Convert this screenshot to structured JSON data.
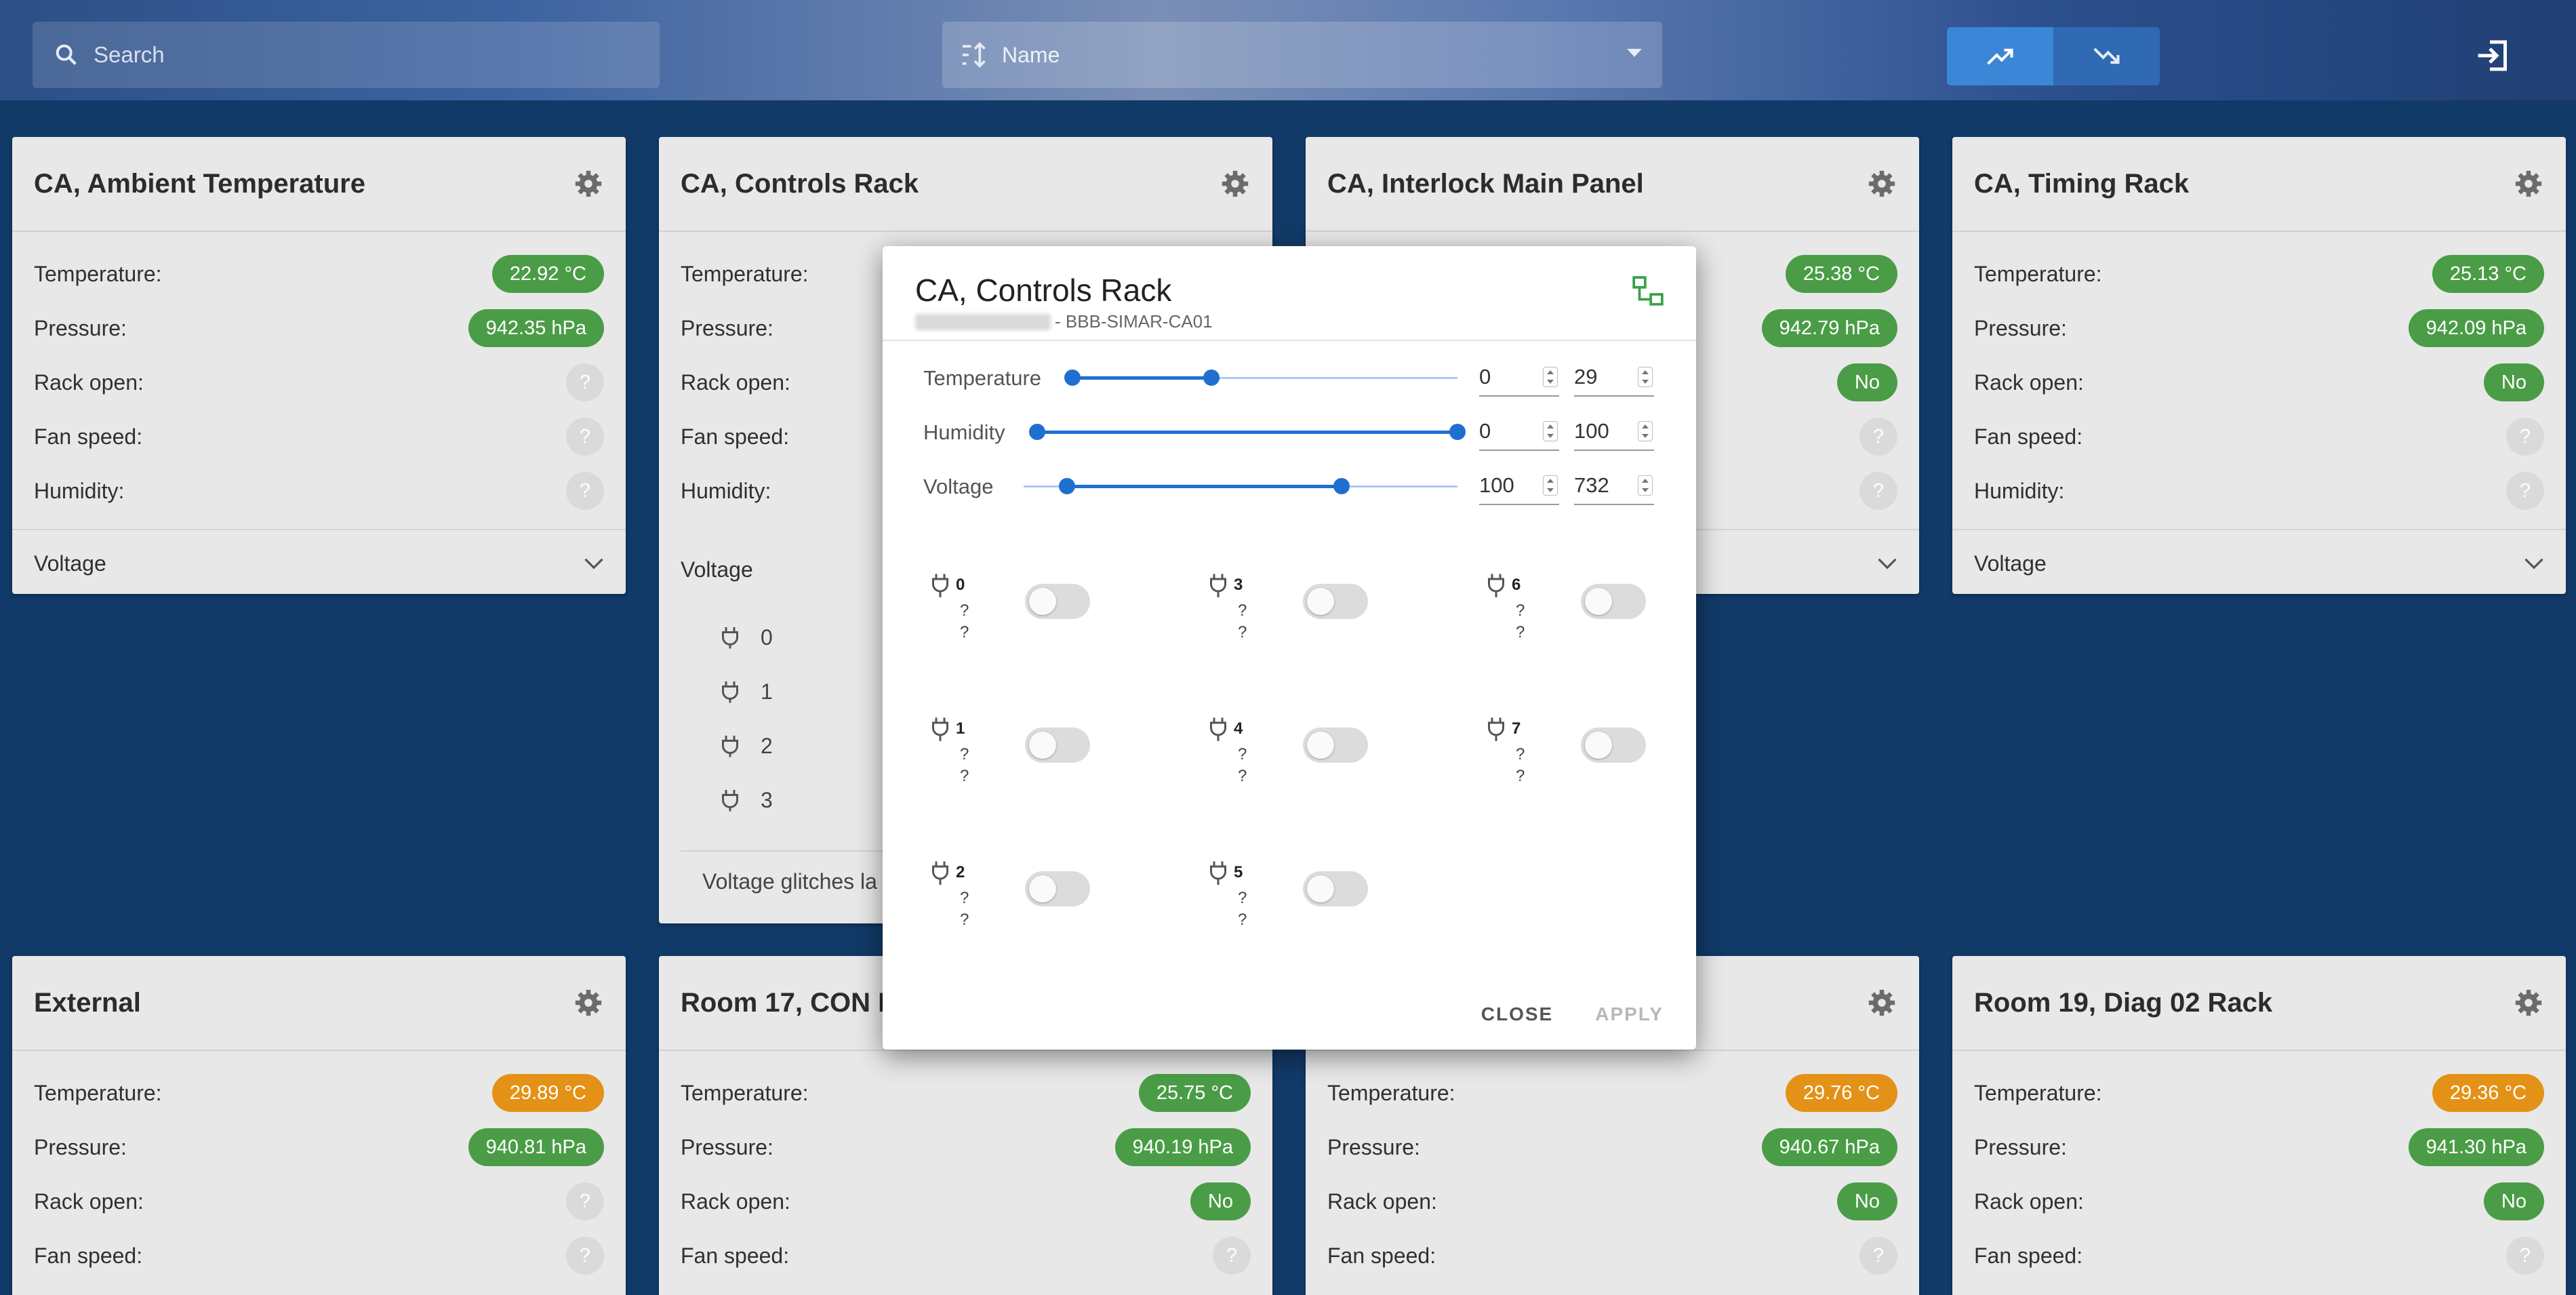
{
  "topbar": {
    "search_placeholder": "Search",
    "sort_label": "Name",
    "icons": [
      "search-icon",
      "sort-icon",
      "trending-up-icon",
      "trending-down-icon",
      "login-icon"
    ]
  },
  "cards_top": [
    {
      "title": "CA, Ambient Temperature",
      "rows": [
        {
          "label": "Temperature:",
          "value": "22.92 °C",
          "status": "green"
        },
        {
          "label": "Pressure:",
          "value": "942.35 hPa",
          "status": "green"
        },
        {
          "label": "Rack open:",
          "value": "?",
          "status": "grey"
        },
        {
          "label": "Fan speed:",
          "value": "?",
          "status": "grey"
        },
        {
          "label": "Humidity:",
          "value": "?",
          "status": "grey"
        }
      ],
      "voltage_label": "Voltage"
    },
    {
      "title": "CA, Controls Rack",
      "rows": [
        {
          "label": "Temperature:"
        },
        {
          "label": "Pressure:"
        },
        {
          "label": "Rack open:"
        },
        {
          "label": "Fan speed:"
        },
        {
          "label": "Humidity:"
        }
      ],
      "voltage_label": "Voltage",
      "outlets": [
        "0",
        "1",
        "2",
        "3"
      ],
      "glitches_label": "Voltage glitches la"
    },
    {
      "title": "CA, Interlock Main Panel",
      "rows": [
        {
          "value": "25.38 °C",
          "status": "green"
        },
        {
          "value": "942.79 hPa",
          "status": "green"
        },
        {
          "value": "No",
          "status": "green"
        },
        {
          "value": "?",
          "status": "grey"
        },
        {
          "value": "?",
          "status": "grey"
        }
      ]
    },
    {
      "title": "CA, Timing Rack",
      "rows": [
        {
          "label": "Temperature:",
          "value": "25.13 °C",
          "status": "green"
        },
        {
          "label": "Pressure:",
          "value": "942.09 hPa",
          "status": "green"
        },
        {
          "label": "Rack open:",
          "value": "No",
          "status": "green"
        },
        {
          "label": "Fan speed:",
          "value": "?",
          "status": "grey"
        },
        {
          "label": "Humidity:",
          "value": "?",
          "status": "grey"
        }
      ],
      "voltage_label": "Voltage"
    }
  ],
  "cards_bottom": [
    {
      "title": "External",
      "rows": [
        {
          "label": "Temperature:",
          "value": "29.89 °C",
          "status": "orange"
        },
        {
          "label": "Pressure:",
          "value": "940.81 hPa",
          "status": "green"
        },
        {
          "label": "Rack open:",
          "value": "?",
          "status": "grey"
        },
        {
          "label": "Fan speed:",
          "value": "?",
          "status": "grey"
        }
      ]
    },
    {
      "title": "Room 17, CON R",
      "rows": [
        {
          "label": "Temperature:",
          "value": "25.75 °C",
          "status": "green"
        },
        {
          "label": "Pressure:",
          "value": "940.19 hPa",
          "status": "green"
        },
        {
          "label": "Rack open:",
          "value": "No",
          "status": "green"
        },
        {
          "label": "Fan speed:",
          "value": "?",
          "status": "grey"
        }
      ]
    },
    {
      "title": "",
      "rows": [
        {
          "label": "Temperature:",
          "value": "29.76 °C",
          "status": "orange"
        },
        {
          "label": "Pressure:",
          "value": "940.67 hPa",
          "status": "green"
        },
        {
          "label": "Rack open:",
          "value": "No",
          "status": "green"
        },
        {
          "label": "Fan speed:",
          "value": "?",
          "status": "grey"
        }
      ]
    },
    {
      "title": "Room 19, Diag 02 Rack",
      "rows": [
        {
          "label": "Temperature:",
          "value": "29.36 °C",
          "status": "orange"
        },
        {
          "label": "Pressure:",
          "value": "941.30 hPa",
          "status": "green"
        },
        {
          "label": "Rack open:",
          "value": "No",
          "status": "green"
        },
        {
          "label": "Fan speed:",
          "value": "?",
          "status": "grey"
        }
      ]
    }
  ],
  "dialog": {
    "title": "CA, Controls Rack",
    "subtitle": "- BBB-SIMAR-CA01",
    "sliders": [
      {
        "label": "Temperature",
        "min": "0",
        "max": "29"
      },
      {
        "label": "Humidity",
        "min": "0",
        "max": "100"
      },
      {
        "label": "Voltage",
        "min": "100",
        "max": "732"
      }
    ],
    "outlets": [
      {
        "num": "0",
        "l1": "?",
        "l2": "?"
      },
      {
        "num": "1",
        "l1": "?",
        "l2": "?"
      },
      {
        "num": "2",
        "l1": "?",
        "l2": "?"
      },
      {
        "num": "3",
        "l1": "?",
        "l2": "?"
      },
      {
        "num": "4",
        "l1": "?",
        "l2": "?"
      },
      {
        "num": "5",
        "l1": "?",
        "l2": "?"
      },
      {
        "num": "6",
        "l1": "?",
        "l2": "?"
      },
      {
        "num": "7",
        "l1": "?",
        "l2": "?"
      }
    ],
    "close_label": "CLOSE",
    "apply_label": "APPLY"
  },
  "colors": {
    "green": "#4a9d46",
    "orange": "#e39217",
    "grey": "#dadada",
    "accent": "#1f6fd1"
  }
}
